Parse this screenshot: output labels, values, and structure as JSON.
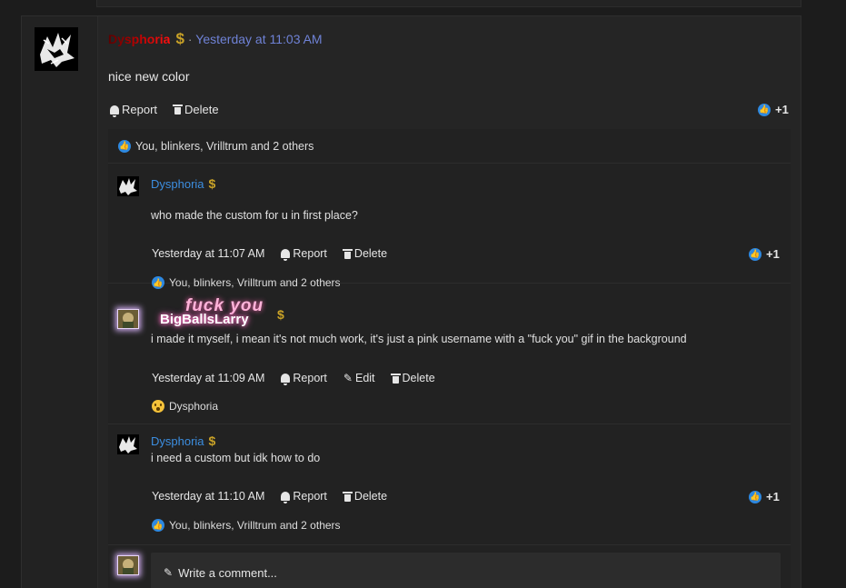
{
  "post": {
    "username": "Dysphoria",
    "badge": "$",
    "separator": "·",
    "time": "Yesterday at 11:03 AM",
    "body": "nice new color",
    "actions": {
      "report": "Report",
      "delete": "Delete"
    },
    "like_count": "+1",
    "reactions_text": "You, blinkers, Vrilltrum and 2 others"
  },
  "comments": [
    {
      "username": "Dysphoria",
      "badge": "$",
      "text": "who made the custom for u in first place?",
      "time": "Yesterday at 11:07 AM",
      "report": "Report",
      "delete": "Delete",
      "like_count": "+1",
      "reactions_text": "You, blinkers, Vrilltrum and 2 others"
    },
    {
      "username": "BigBallsLarry",
      "banner": "fuck you",
      "badge": "$",
      "text": "i made it myself, i mean it's not much work, it's just a pink username with a \"fuck you\" gif in the background",
      "time": "Yesterday at 11:09 AM",
      "report": "Report",
      "edit": "Edit",
      "delete": "Delete",
      "reactions_text": "Dysphoria"
    },
    {
      "username": "Dysphoria",
      "badge": "$",
      "text": "i need a custom but idk how to do",
      "time": "Yesterday at 11:10 AM",
      "report": "Report",
      "delete": "Delete",
      "like_count": "+1",
      "reactions_text": "You, blinkers, Vrilltrum and 2 others"
    }
  ],
  "comment_box": {
    "placeholder": "Write a comment..."
  },
  "icons": {
    "report": "bell-icon",
    "delete": "trash-icon",
    "edit": "pencil-icon",
    "like": "thumbs-up-icon",
    "wow": "wow-emoji-icon"
  },
  "colors": {
    "background": "#1c1c1c",
    "card": "#252525",
    "link_blue": "#3c8ee0",
    "timestamp_blue": "#6f82d6",
    "like_blue": "#2d88e0",
    "badge_gold": "#c9a227",
    "username_red": "#ff1010",
    "larry_pink": "#ff6fc3"
  }
}
